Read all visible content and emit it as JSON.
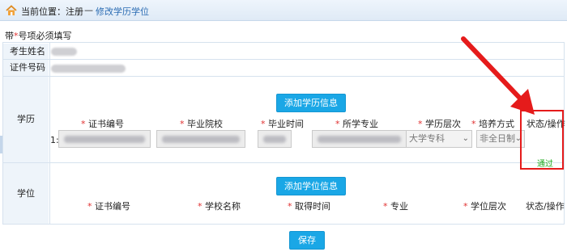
{
  "breadcrumb": {
    "label": "当前位置：注册",
    "separator": "—",
    "current": "修改学历学位"
  },
  "notice": {
    "prefix": "带",
    "star": "*",
    "suffix": "号项必须填写"
  },
  "fields": {
    "name_label": "考生姓名",
    "id_label": "证件号码"
  },
  "education": {
    "section_label": "学历",
    "add_button": "添加学历信息",
    "columns": [
      "证书编号",
      "毕业院校",
      "毕业时间",
      "所学专业",
      "学历层次",
      "培养方式",
      "状态/操作"
    ],
    "required": [
      true,
      true,
      true,
      true,
      true,
      true,
      false
    ],
    "rows": [
      {
        "index": "1:",
        "level": "大学专科",
        "mode": "非全日制",
        "status": "通过"
      }
    ]
  },
  "degree": {
    "section_label": "学位",
    "add_button": "添加学位信息",
    "columns": [
      "证书编号",
      "学校名称",
      "取得时间",
      "专业",
      "学位层次",
      "状态/操作"
    ],
    "required": [
      true,
      true,
      true,
      true,
      true,
      false
    ]
  },
  "save_button": "保存",
  "colors": {
    "button": "#1aa7e6",
    "required_star": "#e03030",
    "status_ok": "#22aa22",
    "annotation": "#e51b1b",
    "link": "#2b6cb3"
  },
  "icons": [
    "home-icon",
    "arrow-annotation-icon",
    "chevron-down-icon"
  ]
}
